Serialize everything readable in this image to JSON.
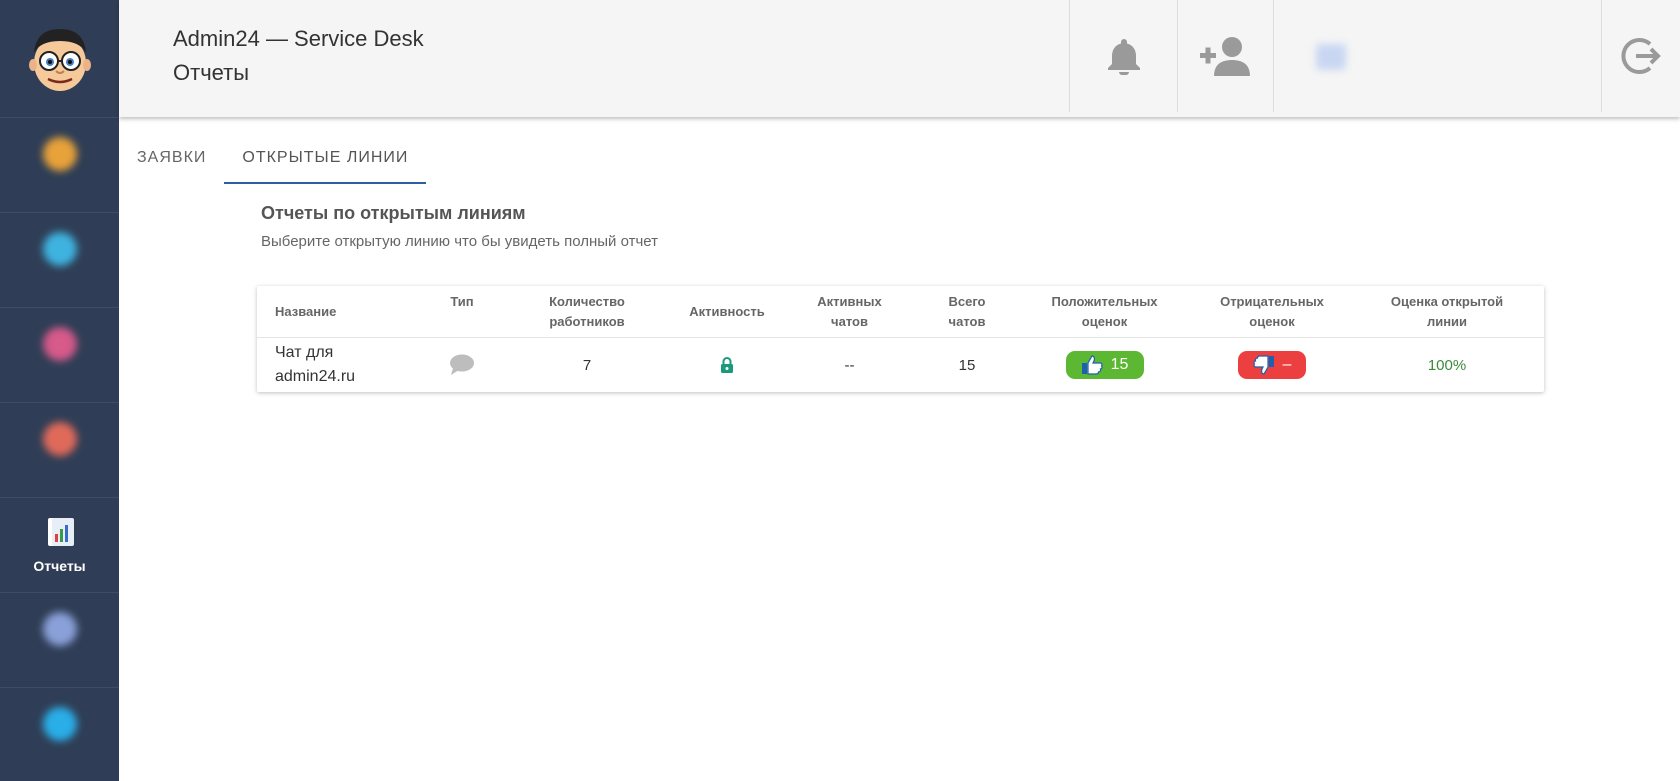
{
  "header": {
    "title": "Admin24 — Service Desk",
    "subtitle": "Отчеты"
  },
  "sidebar": {
    "active_label": "Отчеты"
  },
  "tabs": [
    {
      "label": "ЗАЯВКИ",
      "active": false
    },
    {
      "label": "ОТКРЫТЫЕ ЛИНИИ",
      "active": true
    }
  ],
  "section": {
    "title": "Отчеты по открытым линиям",
    "description": "Выберите открытую линию что бы увидеть полный отчет"
  },
  "table": {
    "headers": {
      "name": "Название",
      "type": "Тип",
      "workers_1": "Количество",
      "workers_2": "работников",
      "activity": "Активность",
      "active_chats_1": "Активных",
      "active_chats_2": "чатов",
      "total_chats_1": "Всего",
      "total_chats_2": "чатов",
      "positive_1": "Положительных",
      "positive_2": "оценок",
      "negative_1": "Отрицательных",
      "negative_2": "оценок",
      "rating_1": "Оценка открытой",
      "rating_2": "линии"
    },
    "rows": [
      {
        "name_1": "Чат для",
        "name_2": "admin24.ru",
        "type_icon": "chat-bubble-icon",
        "workers": "7",
        "activity_icon": "lock-icon",
        "active_chats": "--",
        "total_chats": "15",
        "positive": "15",
        "negative": "–",
        "rating": "100%"
      }
    ]
  },
  "colors": {
    "sidebar_bg": "#2f3e56",
    "header_bg": "#f5f5f5",
    "tab_active_underline": "#2f5fa0",
    "positive_pill": "#5cb832",
    "negative_pill": "#ec4040",
    "rating_text": "#3a8a3a",
    "lock_icon": "#1a9a7a"
  }
}
